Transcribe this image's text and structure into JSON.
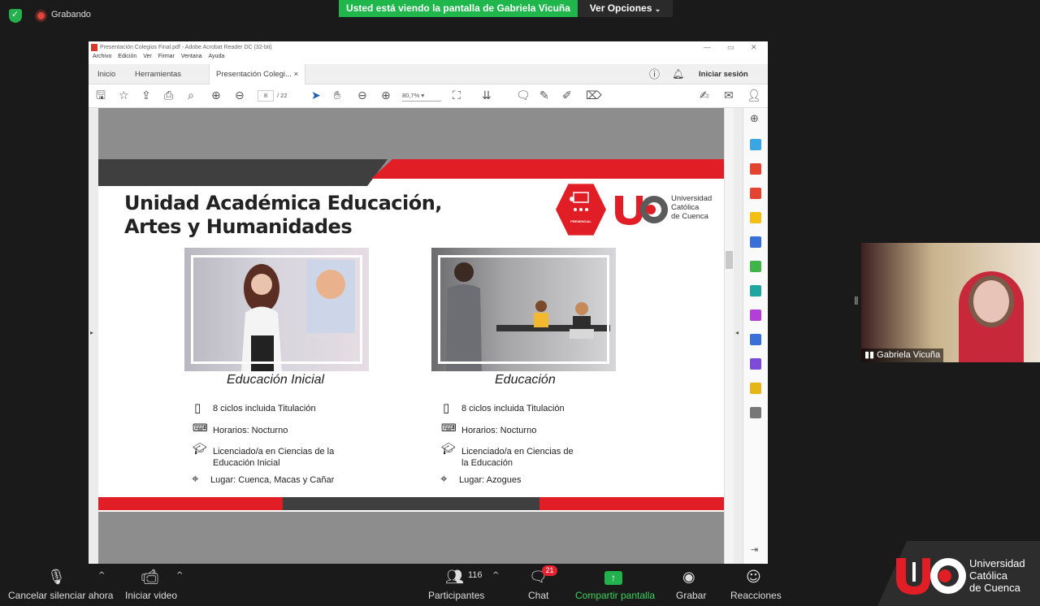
{
  "zoom": {
    "recording_label": "Grabando",
    "sharing_banner": "Usted está viendo la pantalla de Gabriela Vicuña",
    "view_options": "Ver Opciones",
    "participant_name": "Gabriela Vicuña",
    "participants_count": "116",
    "chat_badge": "21",
    "buttons": {
      "mute": "Cancelar silenciar ahora",
      "video": "Iniciar video",
      "participants": "Participantes",
      "chat": "Chat",
      "share": "Compartir pantalla",
      "record": "Grabar",
      "reactions": "Reacciones"
    },
    "brand_line1": "Universidad",
    "brand_line2": "Católica",
    "brand_line3": "de Cuenca"
  },
  "acrobat": {
    "title": "Presentación Colegios Final.pdf - Adobe Acrobat Reader DC (32-bit)",
    "menu": [
      "Archivo",
      "Edición",
      "Ver",
      "Firmar",
      "Ventana",
      "Ayuda"
    ],
    "tabs": {
      "home": "Inicio",
      "tools": "Herramientas",
      "doc": "Presentación Colegi..."
    },
    "sign_in": "Iniciar sesión",
    "page_current": "8",
    "page_total": "/ 22",
    "zoom_value": "80,7%"
  },
  "slide": {
    "title_line1": "Unidad Académica Educación,",
    "title_line2": "Artes y Humanidades",
    "badge_label": "PRESENCIAL",
    "uc_name_line1": "Universidad",
    "uc_name_line2": "Católica",
    "uc_name_line3": "de Cuenca",
    "programs": [
      {
        "name": "Educación Inicial",
        "cycles": "8 ciclos incluida Titulación",
        "schedule": "Horarios: Nocturno",
        "degree_line1": "Licenciado/a en Ciencias de la",
        "degree_line2": "Educación Inicial",
        "place": "Lugar: Cuenca, Macas y Cañar"
      },
      {
        "name": "Educación",
        "cycles": "8 ciclos incluida Titulación",
        "schedule": "Horarios: Nocturno",
        "degree_line1": "Licenciado/a en Ciencias de",
        "degree_line2": "la Educación",
        "place": "Lugar: Azogues"
      }
    ]
  },
  "colors": {
    "accent_red": "#e11d25",
    "zoom_green": "#1fb64c",
    "dark_band": "#3f3f3f"
  }
}
